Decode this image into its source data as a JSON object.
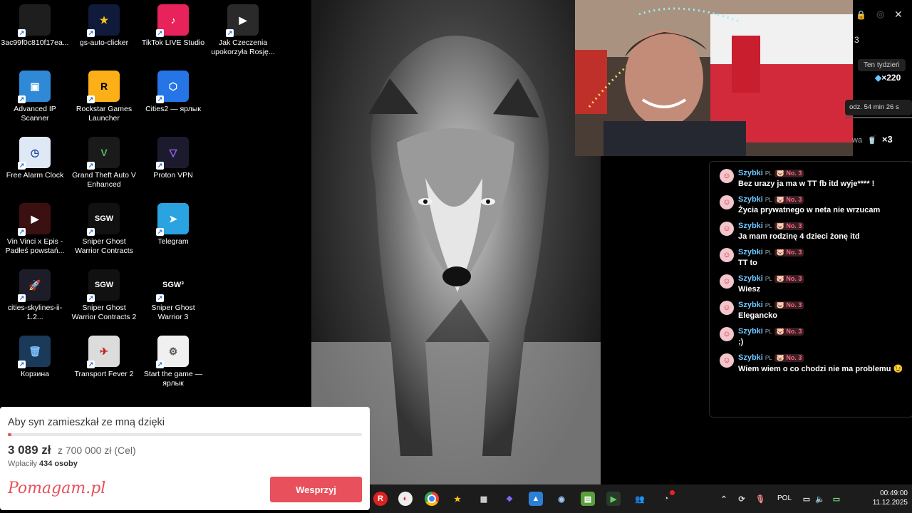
{
  "desktop": {
    "icons": [
      {
        "label": "3ac99f0c810f17ea...",
        "symbol": "",
        "bg": "#1e1e1e",
        "fg": "#ccc"
      },
      {
        "label": "gs-auto-clicker",
        "symbol": "★",
        "bg": "#101a3a",
        "fg": "#f5c518"
      },
      {
        "label": "TikTok LIVE Studio",
        "symbol": "♪",
        "bg": "#e8225a",
        "fg": "#fff"
      },
      {
        "label": "Jak Czeczenia upokorzyła Rosję...",
        "symbol": "▶",
        "bg": "#2a2a2a",
        "fg": "#fff"
      },
      {
        "label": "Advanced IP Scanner",
        "symbol": "▣",
        "bg": "#2f89d6",
        "fg": "#fff"
      },
      {
        "label": "Rockstar Games Launcher",
        "symbol": "R",
        "bg": "#fcaf17",
        "fg": "#000"
      },
      {
        "label": "Cities2 — ярлык",
        "symbol": "⬡",
        "bg": "#2575e6",
        "fg": "#fff"
      },
      {
        "label": "Free Alarm Clock",
        "symbol": "◷",
        "bg": "#dfe8f5",
        "fg": "#1b4aa0"
      },
      {
        "label": "Grand Theft Auto V Enhanced",
        "symbol": "V",
        "bg": "#1a1a1a",
        "fg": "#5bb06a"
      },
      {
        "label": "Proton VPN",
        "symbol": "▽",
        "bg": "#1c1b2e",
        "fg": "#9b6bff"
      },
      {
        "label": "Vin Vinci x Epis - Padłeś powstań...",
        "symbol": "▶",
        "bg": "#3a1010",
        "fg": "#fff"
      },
      {
        "label": "Sniper Ghost Warrior Contracts",
        "symbol": "SGW",
        "bg": "#111",
        "fg": "#fff"
      },
      {
        "label": "Telegram",
        "symbol": "➤",
        "bg": "#2aa3e0",
        "fg": "#fff"
      },
      {
        "label": "cities-skylines-ii-1.2...",
        "symbol": "🚀",
        "bg": "#1d1d2a",
        "fg": "#fff"
      },
      {
        "label": "Sniper Ghost Warrior Contracts 2",
        "symbol": "SGW",
        "bg": "#111",
        "fg": "#fff"
      },
      {
        "label": "Sniper Ghost Warrior 3",
        "symbol": "SGW³",
        "bg": "#000",
        "fg": "#fff"
      },
      {
        "label": "Корзина",
        "symbol": "🗑",
        "bg": "#1b3a5a",
        "fg": "#7fc4ff"
      },
      {
        "label": "Transport Fever 2",
        "symbol": "✈",
        "bg": "#dcdcdc",
        "fg": "#b22"
      },
      {
        "label": "Start the game — ярлык",
        "symbol": "⚙",
        "bg": "#f0f0f0",
        "fg": "#555"
      }
    ]
  },
  "stream_overlay": {
    "week_filter": "Ten tydzień",
    "diamonds": "×220",
    "rank_number": "3",
    "timer_text": "odz. 54 min 26 s",
    "gift_partial": "wa",
    "gift_count": "×3"
  },
  "chat": {
    "messages": [
      {
        "user": "Szybki",
        "flag": "PL",
        "badge": "No. 3",
        "text": "Bez urazy ja ma w TT fb itd wyje**** !"
      },
      {
        "user": "Szybki",
        "flag": "PL",
        "badge": "No. 3",
        "text": "Życia prywatnego w neta nie wrzucam"
      },
      {
        "user": "Szybki",
        "flag": "PL",
        "badge": "No. 3",
        "text": "Ja mam rodzinę 4 dzieci żonę itd"
      },
      {
        "user": "Szybki",
        "flag": "PL",
        "badge": "No. 3",
        "text": "TT to"
      },
      {
        "user": "Szybki",
        "flag": "PL",
        "badge": "No. 3",
        "text": "Wiesz"
      },
      {
        "user": "Szybki",
        "flag": "PL",
        "badge": "No. 3",
        "text": "Elegancko"
      },
      {
        "user": "Szybki",
        "flag": "PL",
        "badge": "No. 3",
        "text": ";)"
      },
      {
        "user": "Szybki",
        "flag": "PL",
        "badge": "No. 3",
        "text": "Wiem wiem o co chodzi nie ma problemu 😉"
      }
    ]
  },
  "fundraiser": {
    "title": "Aby syn zamieszkał ze mną dzięki",
    "raised": "3 089 zł",
    "goal": "z 700 000 zł (Cel)",
    "donors_prefix": "Wpłaciły",
    "donors_count": "434 osoby",
    "logo": "Pomagam.pl",
    "button": "Wesprzyj",
    "progress_fraction": 0.0044
  },
  "taskbar": {
    "language": "POL",
    "time": "00:49:00",
    "date": "11.12.2025"
  },
  "colors": {
    "accent": "#e8505b",
    "chat_user": "#6ec6ff",
    "badge": "#ff6b7f"
  }
}
